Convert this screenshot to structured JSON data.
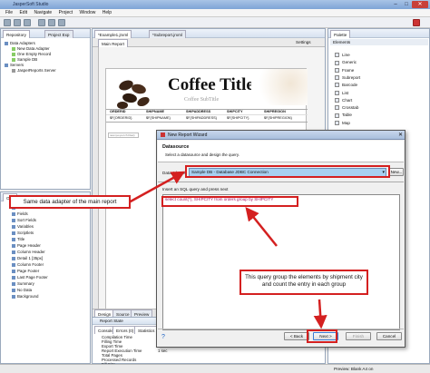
{
  "window": {
    "title": "JasperSoft Studio"
  },
  "menu": [
    "File",
    "Edit",
    "Navigate",
    "Project",
    "Window",
    "Help"
  ],
  "repository": {
    "tabs": [
      "Repository",
      "Project Exp"
    ],
    "items": [
      {
        "label": "Data Adapters",
        "level": 0
      },
      {
        "label": "New Data Adapter",
        "level": 1
      },
      {
        "label": "One Empty Record",
        "level": 1
      },
      {
        "label": "Sample DB",
        "level": 1
      },
      {
        "label": "Servers",
        "level": 0
      },
      {
        "label": "JasperReports Server",
        "level": 1
      }
    ]
  },
  "editor": {
    "tabs": [
      "*Example1.jrxml",
      "*Subreport.jrxml"
    ],
    "subtab": "Main Report",
    "settings_label": "Settings",
    "report_title": "Coffee Title",
    "report_subtitle": "Coffee SubTitle",
    "columns": [
      "ORDERID",
      "SHIPNAME",
      "SHIPADDRESS",
      "SHIPCITY",
      "SHIPREGION"
    ],
    "fields": [
      "$F{ORDERID}",
      "$F{SHIPNAME}",
      "$F{SHIPADDRESS}",
      "$F{SHIPCITY}",
      "$F{SHIPREGION}"
    ],
    "band_label": "new (ex-pol ch Dset)",
    "bottom_tabs": [
      "Design",
      "Source",
      "Preview"
    ]
  },
  "outline": {
    "tab": "Outl",
    "items": [
      "Parameters",
      "Fields",
      "Sort Fields",
      "Variables",
      "Scriptlets",
      "Title",
      "Page Header",
      "Column Header",
      "Detail 1 [35px]",
      "Column Footer",
      "Page Footer",
      "Last Page Footer",
      "Summary",
      "No Data",
      "Background"
    ]
  },
  "report_state": {
    "tabs": [
      "Console",
      "Errors (0)",
      "Statistics"
    ],
    "panel_title": "Report State",
    "rows": [
      {
        "label": "Compilation Time",
        "value": ""
      },
      {
        "label": "Filling Time",
        "value": ""
      },
      {
        "label": "Export Time",
        "value": ""
      },
      {
        "label": "Report Execution Time",
        "value": "1 sec"
      },
      {
        "label": "Total Pages",
        "value": ""
      },
      {
        "label": "Processed Records",
        "value": ""
      },
      {
        "label": "Fill Size",
        "value": ""
      }
    ]
  },
  "palette": {
    "title": "Palette",
    "section": "Elements",
    "items": [
      "Line",
      "Generic",
      "Frame",
      "Subreport",
      "Barcode",
      "List",
      "Chart",
      "Crosstab",
      "Table",
      "Map"
    ]
  },
  "wizard": {
    "title": "New Report Wizard",
    "section_title": "Datasource",
    "section_desc": "Select a datasource and design the query.",
    "adapter_label": "Data Adapter",
    "adapter_value": "Sample DB - Database JDBC Connection",
    "adapter_button": "New...",
    "query_label": "Insert an SQL query and press next",
    "query_text": "select count(*), SHIPCITY from orders group by SHIPCITY",
    "buttons": {
      "back": "< Back",
      "next": "Next >",
      "finish": "Finish",
      "cancel": "Cancel"
    }
  },
  "annotations": {
    "adapter_note": "Same data adapter of the main report",
    "query_note": "This query group the elements by shipment city and count the entry in each group"
  },
  "status_bar": {
    "text": "Preview: Blank A4 on"
  },
  "colors": {
    "accent": "#d42020",
    "selection": "#3399ff",
    "adapter_highlight": "#a7d0f0"
  }
}
